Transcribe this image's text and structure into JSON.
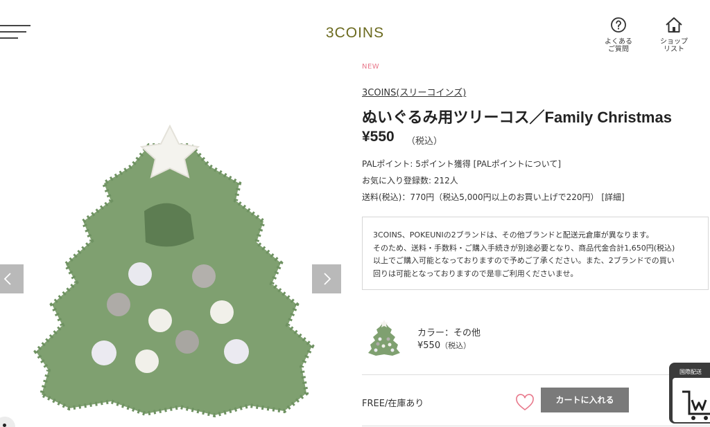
{
  "header": {
    "logo": "3COINS",
    "faq_label": "よくある\nご質問",
    "shop_label": "ショップ\nリスト"
  },
  "product": {
    "new_tag": "NEW",
    "brand": "3COINS(スリーコインズ)",
    "title": "ぬいぐるみ用ツリーコス／Family Christmas",
    "price": "¥550",
    "tax_note": "（税込）",
    "points": "PALポイント: 5ポイント獲得 [PALポイントについて]",
    "favorites": "お気に入り登録数: 212人",
    "shipping": "送料(税込)：770円（税込5,000円以上のお買い上げで220円）",
    "shipping_detail_link": "[詳細]"
  },
  "notice": {
    "lines": [
      "3COINS、POKEUNIの2ブランドは、その他ブランドと配送元倉庫が異なります。",
      "そのため、送料・手数料・ご購入手続きが別途必要となり、商品代金合計1,650円(税込)",
      "以上でご購入可能となっておりますので予めご了承ください。また、2ブランドでの買い",
      "回りは可能となっておりますので是非ご利用くださいませ。"
    ]
  },
  "variant": {
    "color": "カラー：その他",
    "price": "¥550",
    "tax_note": "（税込）",
    "stock": "FREE/在庫あり",
    "add_to_cart": "カートに入れる"
  },
  "intl_badge": {
    "label": "国際配送"
  },
  "colors": {
    "logo": "#6b6a1e",
    "tree_green": "#7fa070",
    "cart_button": "#7a7a7a",
    "new_tag": "#e8788b",
    "heart": "#e8788b"
  },
  "icons": {
    "menu": "hamburger-icon",
    "faq": "question-circle-icon",
    "shop": "house-icon",
    "prev": "chevron-left-icon",
    "next": "chevron-right-icon",
    "favorite": "heart-icon"
  }
}
